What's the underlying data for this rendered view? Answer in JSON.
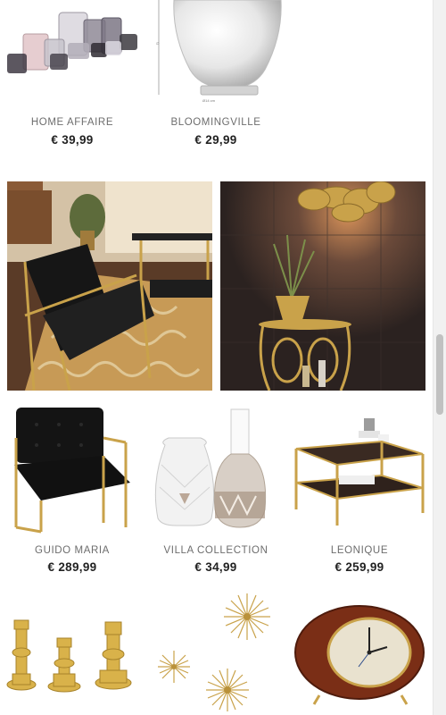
{
  "products_row1": [
    {
      "brand": "HOME AFFAIRE",
      "price": "€ 39,99",
      "image": "tealight-holders-set"
    },
    {
      "brand": "BLOOMINGVILLE",
      "price": "€ 29,99",
      "image": "glass-hurricane-lantern"
    }
  ],
  "lifestyle_images": [
    {
      "image": "living-room-velvet-armchair-scene"
    },
    {
      "image": "gold-bar-table-with-pendant-lamp-scene"
    }
  ],
  "products_row2": [
    {
      "brand": "GUIDO MARIA",
      "price": "€ 289,99",
      "image": "black-velvet-armchair-gold-frame"
    },
    {
      "brand": "VILLA COLLECTION",
      "price": "€ 34,99",
      "image": "ceramic-vases-pair"
    },
    {
      "brand": "LEONIQUE",
      "price": "€ 259,99",
      "image": "coffee-table-gold-frame"
    }
  ],
  "products_row3": [
    {
      "image": "gold-candle-holders"
    },
    {
      "image": "gold-starburst-wall-decor"
    },
    {
      "image": "wooden-table-clock"
    }
  ],
  "colors": {
    "brand_text": "#6d6d6d",
    "price_text": "#222222",
    "gold": "#c9a24a"
  }
}
